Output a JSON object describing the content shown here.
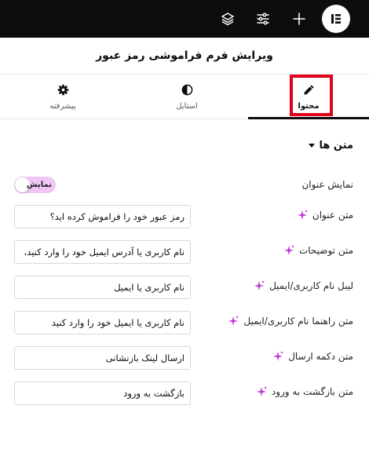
{
  "topbar": {
    "icons": [
      "layers-icon",
      "settings-sliders-icon",
      "plus-icon",
      "elementor-logo"
    ]
  },
  "header": {
    "title": "ویرایش فرم فراموشی رمز عبور"
  },
  "tabs": [
    {
      "label": "محتوا",
      "icon": "pencil-icon",
      "active": true
    },
    {
      "label": "استایل",
      "icon": "contrast-icon",
      "active": false
    },
    {
      "label": "پیشرفته",
      "icon": "gear-icon",
      "active": false
    }
  ],
  "section": {
    "title": "متن ها"
  },
  "fields": {
    "show_title": {
      "label": "نمایش عنوان",
      "toggle_label": "نمایش",
      "on": true
    },
    "title_text": {
      "label": "متن عنوان",
      "value": "رمز عبور خود را فراموش کرده اید؟"
    },
    "description_text": {
      "label": "متن توضیحات",
      "value": "نام کاربری یا آدرس ایمیل خود را وارد کنید، ما"
    },
    "username_label": {
      "label": "لیبل نام کاربری/ایمیل",
      "value": "نام کاربری یا ایمیل"
    },
    "username_hint": {
      "label": "متن راهنما نام کاربری/ایمیل",
      "value": "نام کاربری یا ایمیل خود را وارد کنید"
    },
    "submit_text": {
      "label": "متن دکمه ارسال",
      "value": "ارسال لینک بازنشانی"
    },
    "back_text": {
      "label": "متن بازگشت به ورود",
      "value": "بازگشت به ورود"
    }
  },
  "colors": {
    "topbar": "#0c0d0e",
    "accent_ai": "#c036d6",
    "toggle_bg": "#f0c6f5",
    "highlight": "#e2001a"
  }
}
